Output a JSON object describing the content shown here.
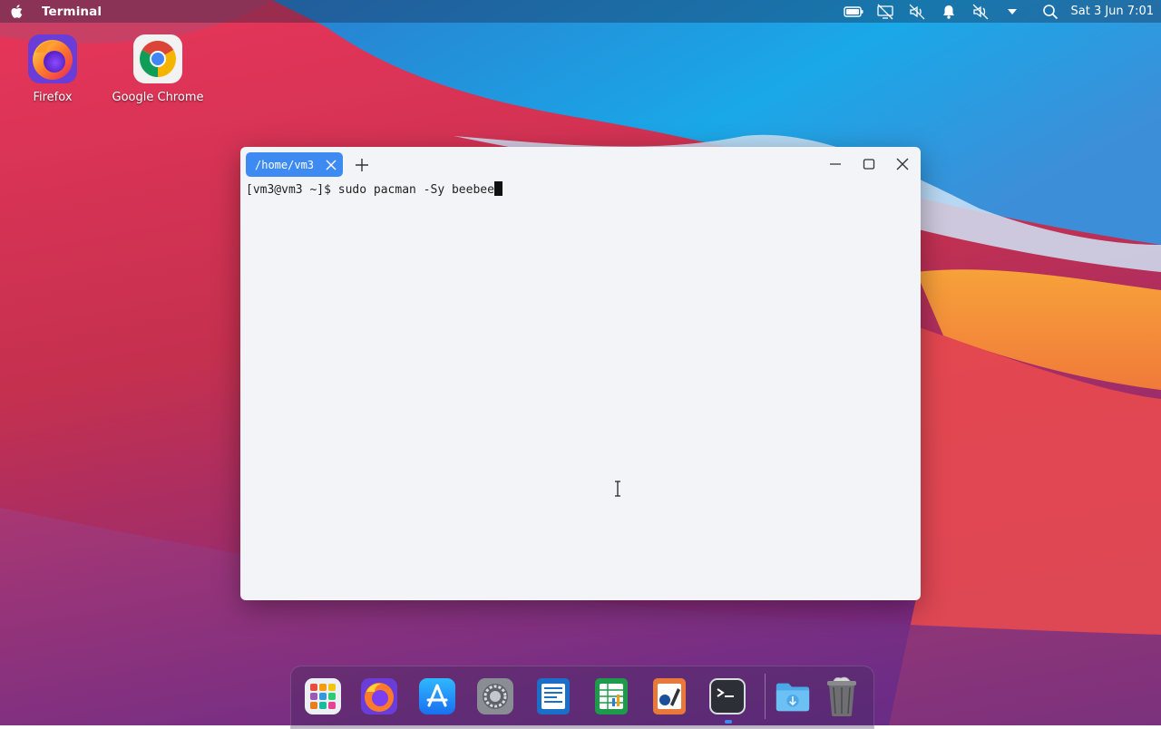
{
  "menubar": {
    "active_app": "Terminal",
    "clock": "Sat 3 Jun  7:01",
    "tray_icons": [
      "battery-icon",
      "network-off-icon",
      "volume-muted-icon",
      "notification-bell-icon",
      "mic-muted-icon",
      "tray-menu-arrow-icon",
      "search-icon"
    ]
  },
  "desktop": {
    "icons": [
      {
        "label": "Firefox",
        "icon": "firefox-icon"
      },
      {
        "label": "Google Chrome",
        "icon": "chrome-icon"
      }
    ]
  },
  "terminal": {
    "tab_title": "/home/vm3",
    "prompt": "[vm3@vm3 ~]$ ",
    "command": "sudo pacman -Sy beebee",
    "colors": {
      "tab": "#3d8bf2",
      "background": "#f3f4f8"
    }
  },
  "dock": {
    "items": [
      {
        "name": "Launchpad",
        "icon": "app-grid-icon"
      },
      {
        "name": "Firefox",
        "icon": "firefox-icon"
      },
      {
        "name": "App Store",
        "icon": "app-store-icon"
      },
      {
        "name": "System Settings",
        "icon": "settings-icon"
      },
      {
        "name": "Writer",
        "icon": "document-icon"
      },
      {
        "name": "Calc",
        "icon": "spreadsheet-icon"
      },
      {
        "name": "Draw",
        "icon": "draw-icon"
      },
      {
        "name": "Terminal",
        "icon": "terminal-icon",
        "running": true
      },
      {
        "name": "Downloads",
        "icon": "downloads-folder-icon"
      },
      {
        "name": "Trash",
        "icon": "trash-icon"
      }
    ]
  }
}
